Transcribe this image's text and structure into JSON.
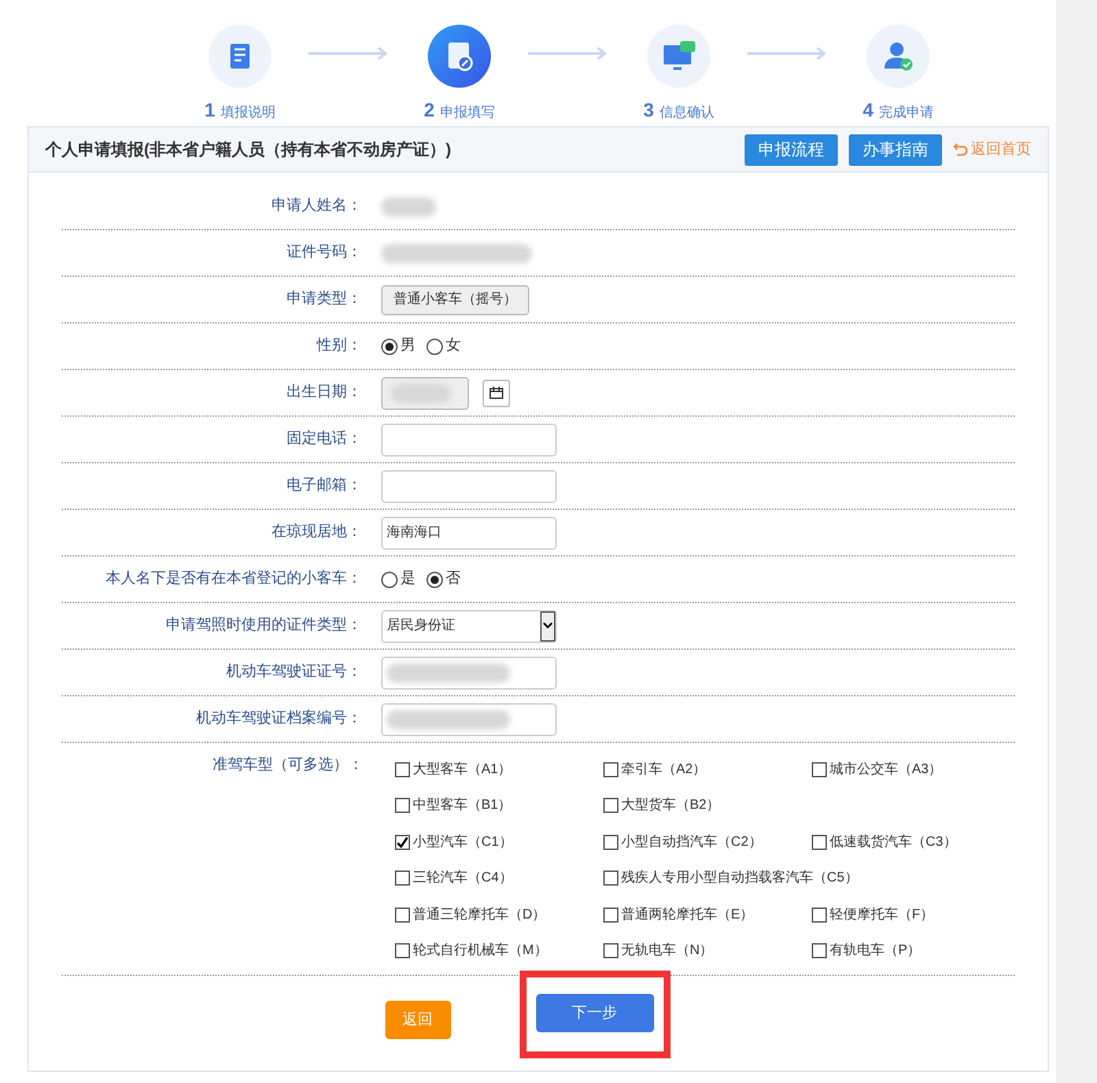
{
  "steps": [
    {
      "number": "1",
      "label": "填报说明",
      "selected": false
    },
    {
      "number": "2",
      "label": "申报填写",
      "selected": true
    },
    {
      "number": "3",
      "label": "信息确认",
      "selected": false
    },
    {
      "number": "4",
      "label": "完成申请",
      "selected": false
    }
  ],
  "header": {
    "title": "个人申请填报(非本省户籍人员（持有本省不动房产证）)",
    "buttons": [
      "申报流程",
      "办事指南"
    ],
    "back_link": "返回首页"
  },
  "fields": [
    {
      "label": "申请人姓名：",
      "kind": "redacted"
    },
    {
      "label": "证件号码：",
      "kind": "redacted"
    },
    {
      "label": "申请类型：",
      "kind": "readonly",
      "value": "普通小客车（摇号）"
    },
    {
      "label": "性别：",
      "kind": "radio",
      "options": [
        {
          "label": "男",
          "selected": true
        },
        {
          "label": "女",
          "selected": false
        }
      ]
    },
    {
      "label": "出生日期：",
      "kind": "date"
    },
    {
      "label": "固定电话：",
      "kind": "input"
    },
    {
      "label": "电子邮箱：",
      "kind": "input"
    },
    {
      "label": "在琼现居地：",
      "kind": "input",
      "value": "海南海口"
    },
    {
      "label": "本人名下是否有在本省登记的小客车：",
      "kind": "radio",
      "options": [
        {
          "label": "是",
          "selected": false
        },
        {
          "label": "否",
          "selected": true
        }
      ]
    },
    {
      "label": "申请驾照时使用的证件类型：",
      "kind": "select",
      "value": "居民身份证"
    },
    {
      "label": "机动车驾驶证证号：",
      "kind": "input",
      "redacted": true
    },
    {
      "label": "机动车驾驶证档案编号：",
      "kind": "input",
      "redacted": true
    }
  ],
  "licence_types": {
    "label": "准驾车型（可多选）：",
    "rows": [
      [
        {
          "label": "大型客车（A1）",
          "checked": false
        },
        {
          "label": "牵引车（A2）",
          "checked": false
        },
        {
          "label": "城市公交车（A3）",
          "checked": false
        }
      ],
      [
        {
          "label": "中型客车（B1）",
          "checked": false
        },
        {
          "label": "大型货车（B2）",
          "checked": false
        }
      ],
      [
        {
          "label": "小型汽车（C1）",
          "checked": true
        },
        {
          "label": "小型自动挡汽车（C2）",
          "checked": false
        },
        {
          "label": "低速载货汽车（C3）",
          "checked": false
        }
      ],
      [
        {
          "label": "三轮汽车（C4）",
          "checked": false
        },
        {
          "label": "残疾人专用小型自动挡载客汽车（C5）",
          "checked": false
        }
      ],
      [
        {
          "label": "普通三轮摩托车（D）",
          "checked": false
        },
        {
          "label": "普通两轮摩托车（E）",
          "checked": false
        },
        {
          "label": "轻便摩托车（F）",
          "checked": false
        }
      ],
      [
        {
          "label": "轮式自行机械车（M）",
          "checked": false
        },
        {
          "label": "无轨电车（N）",
          "checked": false
        },
        {
          "label": "有轨电车（P）",
          "checked": false
        }
      ]
    ]
  },
  "footer_buttons": [
    {
      "label": "返回",
      "kind": "back",
      "highlighted": false
    },
    {
      "label": "下一步",
      "kind": "next",
      "highlighted": true
    }
  ]
}
